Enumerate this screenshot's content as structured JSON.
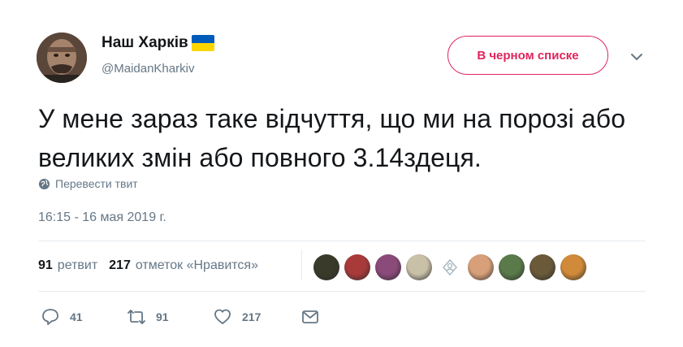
{
  "user": {
    "display_name": "Наш Харків",
    "handle": "@MaidanKharkiv",
    "flag_colors": [
      "#005bbb",
      "#ffd500"
    ]
  },
  "blocked_button": {
    "label": "В черном списке",
    "color": "#e0245e"
  },
  "tweet": {
    "text": "У мене зараз таке відчуття, що ми на порозі або великих змін або повного 3.14здеця.",
    "translate_label": "Перевести твит",
    "timestamp": "16:15 - 16 мая 2019 г."
  },
  "stats": {
    "retweets_count": "91",
    "retweets_label": "ретвит",
    "likes_count": "217",
    "likes_label": "отметок «Нравится»"
  },
  "likers": [
    {
      "icon": "avatar-dark",
      "color": "#3a3a2a"
    },
    {
      "icon": "avatar-red",
      "color": "#a83a3a"
    },
    {
      "icon": "avatar-purple",
      "color": "#8a4a7a"
    },
    {
      "icon": "avatar-person",
      "color": "#c9c0a8"
    },
    {
      "icon": "avatar-default",
      "color": "#ffffff"
    },
    {
      "icon": "avatar-face",
      "color": "#d8a07a"
    },
    {
      "icon": "avatar-plant",
      "color": "#5a7a4a"
    },
    {
      "icon": "avatar-group",
      "color": "#6a5a3a"
    },
    {
      "icon": "avatar-tiger",
      "color": "#d08a3a"
    }
  ],
  "actions": {
    "reply_count": "41",
    "retweet_count": "91",
    "like_count": "217"
  }
}
